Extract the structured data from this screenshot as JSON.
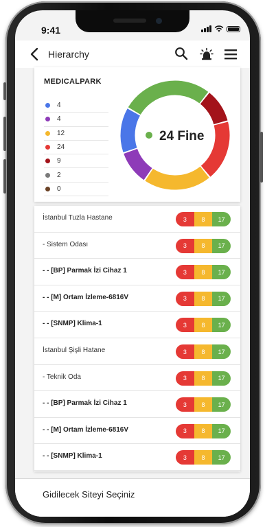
{
  "status_bar": {
    "time": "9:41"
  },
  "header": {
    "title": "Hierarchy",
    "icons": [
      "back-icon",
      "search-icon",
      "alarm-icon",
      "menu-icon"
    ]
  },
  "summary_card": {
    "site_name": "MEDICALPARK",
    "legend": [
      {
        "color": "#4a76e8",
        "value": "4"
      },
      {
        "color": "#8e3bb8",
        "value": "4"
      },
      {
        "color": "#f5b82e",
        "value": "12"
      },
      {
        "color": "#e53935",
        "value": "24"
      },
      {
        "color": "#a3131a",
        "value": "9"
      },
      {
        "color": "#7a7a7a",
        "value": "2"
      },
      {
        "color": "#6b4226",
        "value": "0"
      }
    ],
    "donut": {
      "center_text": "24 Fine",
      "center_dot_color": "#6ab04c",
      "segments": [
        {
          "color": "#6ab04c",
          "value": 24
        },
        {
          "color": "#a3131a",
          "value": 9
        },
        {
          "color": "#e53935",
          "value": 16
        },
        {
          "color": "#f5b82e",
          "value": 18
        },
        {
          "color": "#8e3bb8",
          "value": 9
        },
        {
          "color": "#4a76e8",
          "value": 12
        }
      ]
    }
  },
  "hierarchy_list": [
    {
      "label": "İstanbul Tuzla Hastane",
      "bold": false,
      "counts": [
        "3",
        "8",
        "17"
      ]
    },
    {
      "label": "- Sistem Odası",
      "bold": false,
      "counts": [
        "3",
        "8",
        "17"
      ]
    },
    {
      "label": "- - [BP] Parmak İzi Cihaz 1",
      "bold": true,
      "counts": [
        "3",
        "8",
        "17"
      ]
    },
    {
      "label": "- - [M] Ortam İzleme-6816V",
      "bold": true,
      "counts": [
        "3",
        "8",
        "17"
      ]
    },
    {
      "label": "- - [SNMP] Klima-1",
      "bold": true,
      "counts": [
        "3",
        "8",
        "17"
      ]
    },
    {
      "label": "İstanbul Şişli Hatane",
      "bold": false,
      "counts": [
        "3",
        "8",
        "17"
      ]
    },
    {
      "label": "- Teknik Oda",
      "bold": false,
      "counts": [
        "3",
        "8",
        "17"
      ]
    },
    {
      "label": "- - [BP] Parmak İzi Cihaz 1",
      "bold": true,
      "counts": [
        "3",
        "8",
        "17"
      ]
    },
    {
      "label": "- - [M] Ortam İzleme-6816V",
      "bold": true,
      "counts": [
        "3",
        "8",
        "17"
      ]
    },
    {
      "label": "- - [SNMP] Klima-1",
      "bold": true,
      "counts": [
        "3",
        "8",
        "17"
      ]
    }
  ],
  "pill_colors": {
    "critical": "#e53935",
    "warning": "#f5b82e",
    "ok": "#6ab04c"
  },
  "bottom_bar": {
    "label": "Gidilecek Siteyi Seçiniz"
  }
}
